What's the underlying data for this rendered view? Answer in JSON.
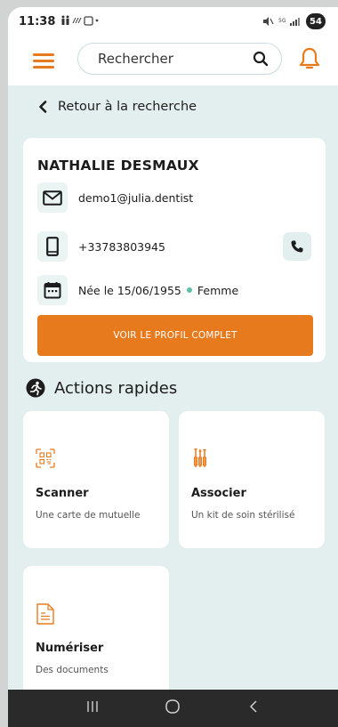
{
  "status_bar": {
    "time": "11:38",
    "battery": "54"
  },
  "header": {
    "search_placeholder": "Rechercher"
  },
  "back_link": {
    "label": "Retour à la recherche"
  },
  "patient": {
    "name": "NATHALIE DESMAUX",
    "email": "demo1@julia.dentist",
    "phone": "+33783803945",
    "birth": "Née le 15/06/1955",
    "gender": "Femme",
    "profile_button": "VOIR LE PROFIL COMPLET"
  },
  "quick_actions": {
    "title": "Actions rapides",
    "items": [
      {
        "title": "Scanner",
        "subtitle": "Une carte de mutuelle",
        "icon": "qr-scan-icon"
      },
      {
        "title": "Associer",
        "subtitle": "Un kit de soin stérilisé",
        "icon": "dental-tools-icon"
      },
      {
        "title": "Numériser",
        "subtitle": "Des documents",
        "icon": "document-icon"
      }
    ]
  },
  "colors": {
    "accent": "#e87a1e",
    "background": "#e3efee",
    "status_dot": "#5cbfa8"
  }
}
